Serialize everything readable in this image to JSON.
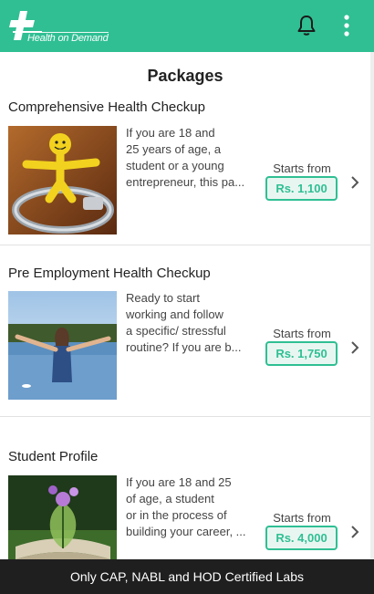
{
  "app": {
    "logo_text": "Health on Demand",
    "brand_color": "#2fbf93",
    "icons": [
      "notification-bell-icon",
      "more-vert-icon"
    ]
  },
  "page": {
    "title": "Packages"
  },
  "packages": [
    {
      "title": "Comprehensive Health Checkup",
      "description_lines": [
        "If you are 18 and",
        "25 years of age, a",
        "student or a young",
        "entrepreneur, this pa..."
      ],
      "starts_label": "Starts from",
      "price": "Rs. 1,100"
    },
    {
      "title": "Pre Employment Health Checkup",
      "description_lines": [
        "Ready to start",
        "working and follow",
        "a specific/ stressful",
        "routine? If you are b..."
      ],
      "starts_label": "Starts from",
      "price": "Rs. 1,750"
    },
    {
      "title": "Student Profile",
      "description_lines": [
        "If you are 18 and 25",
        "of age, a student",
        "or in the process of",
        "building your career, ..."
      ],
      "starts_label": "Starts from",
      "price": "Rs. 4,000"
    }
  ],
  "banner": {
    "text": "Only CAP, NABL and HOD Certified Labs"
  }
}
